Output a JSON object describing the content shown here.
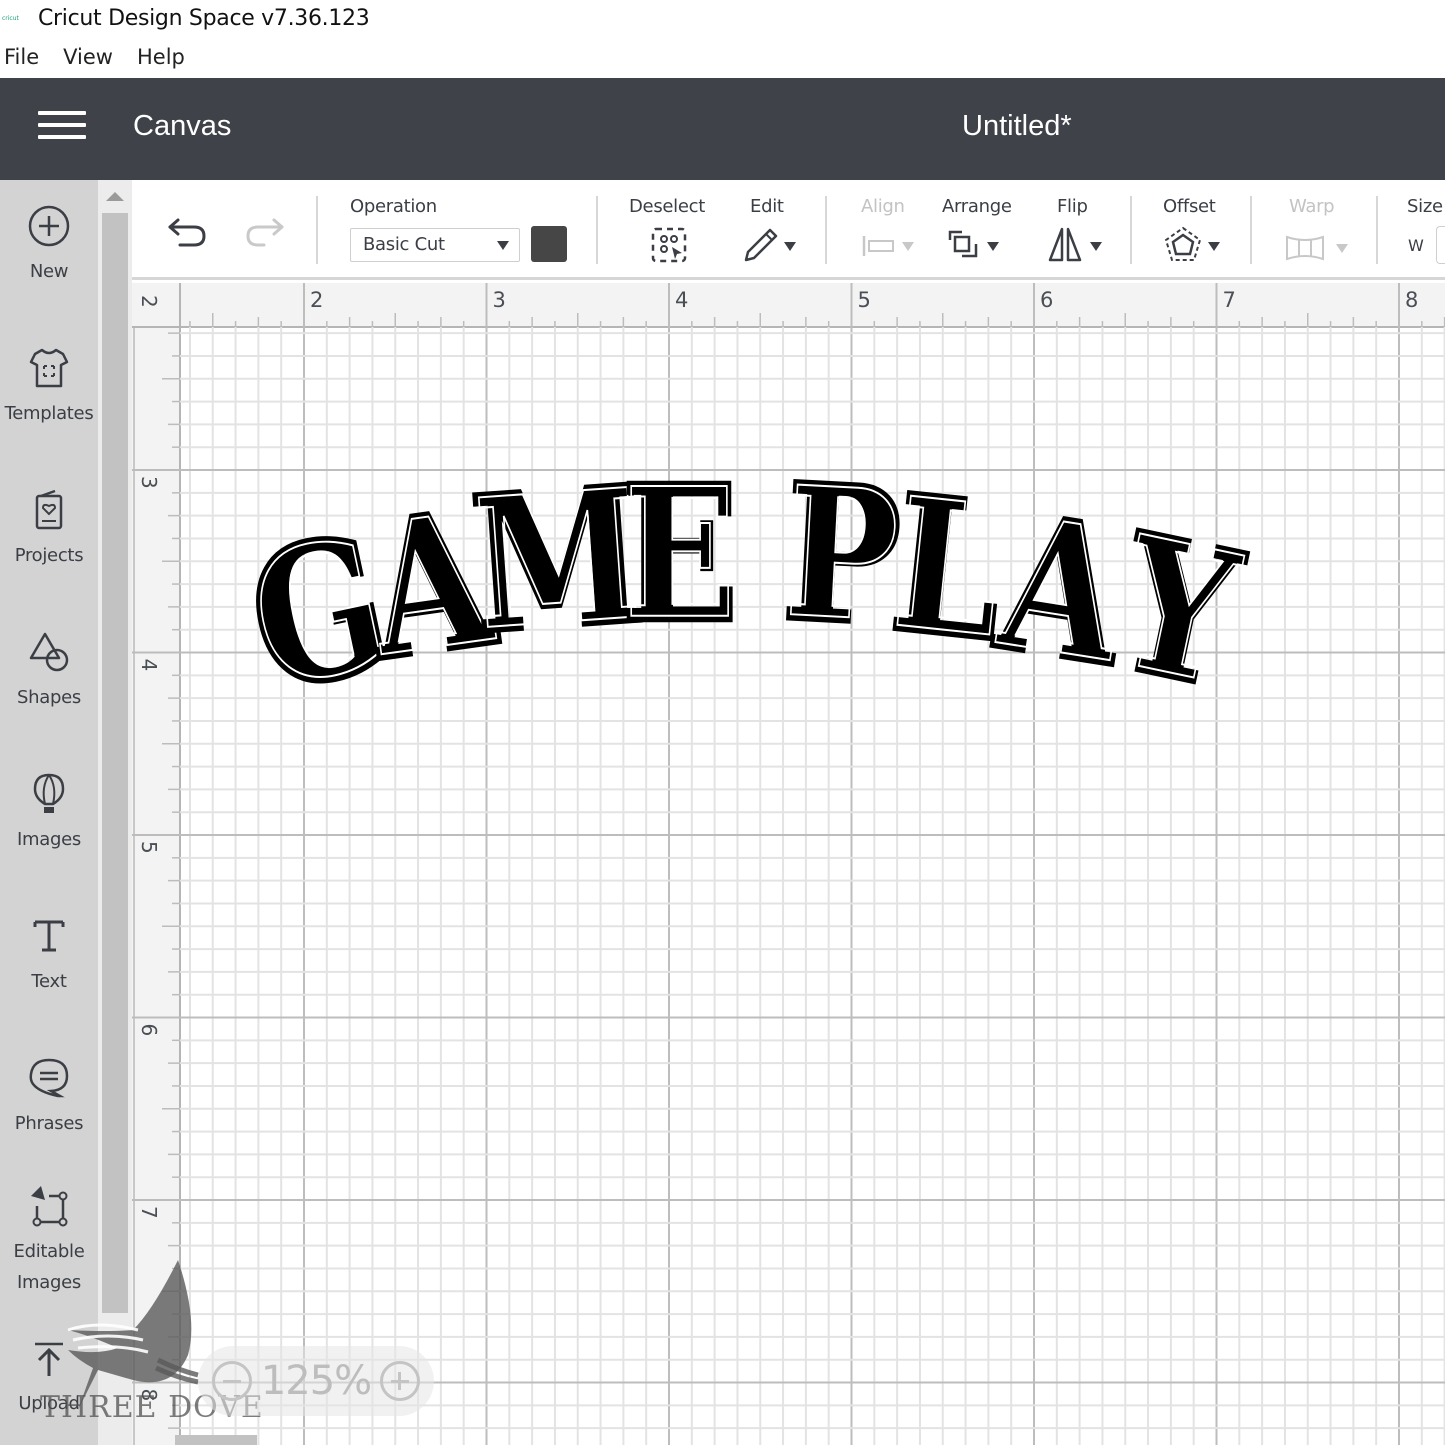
{
  "window": {
    "logo_text": "cricut",
    "title": "Cricut Design Space  v7.36.123"
  },
  "menu": {
    "items": [
      "File",
      "View",
      "Help"
    ]
  },
  "header": {
    "menu_icon": "hamburger-icon",
    "section_title": "Canvas",
    "document_title": "Untitled*"
  },
  "sidebar": {
    "items": [
      {
        "label": "New",
        "icon": "plus-circle-icon"
      },
      {
        "label": "Templates",
        "icon": "tshirt-icon"
      },
      {
        "label": "Projects",
        "icon": "card-heart-icon"
      },
      {
        "label": "Shapes",
        "icon": "triangle-circle-icon"
      },
      {
        "label": "Images",
        "icon": "hot-air-balloon-icon"
      },
      {
        "label": "Text",
        "icon": "text-t-icon"
      },
      {
        "label": "Phrases",
        "icon": "speech-bubble-icon"
      },
      {
        "label": "Editable Images",
        "icon": "editable-node-icon"
      },
      {
        "label": "Upload",
        "icon": "upload-icon"
      }
    ]
  },
  "toolbar": {
    "undo_icon": "undo-icon",
    "redo_icon": "redo-icon",
    "operation": {
      "label": "Operation",
      "value": "Basic Cut",
      "color": "#464646"
    },
    "deselect_label": "Deselect",
    "edit_label": "Edit",
    "align_label": "Align",
    "arrange_label": "Arrange",
    "flip_label": "Flip",
    "offset_label": "Offset",
    "warp_label": "Warp",
    "size_label": "Size",
    "size_w_label": "W"
  },
  "canvas": {
    "ruler_top": [
      "2",
      "3",
      "4",
      "5",
      "6",
      "7",
      "8"
    ],
    "ruler_left": [
      "2",
      "3",
      "4",
      "5",
      "6",
      "7",
      "8"
    ],
    "design_text_1": "GAME",
    "design_text_2": "PLAY",
    "design_fill": "#000000",
    "design_outline": "#ffffff"
  },
  "zoom": {
    "level": "125%"
  },
  "watermark": {
    "text": "THREE DOVE"
  }
}
